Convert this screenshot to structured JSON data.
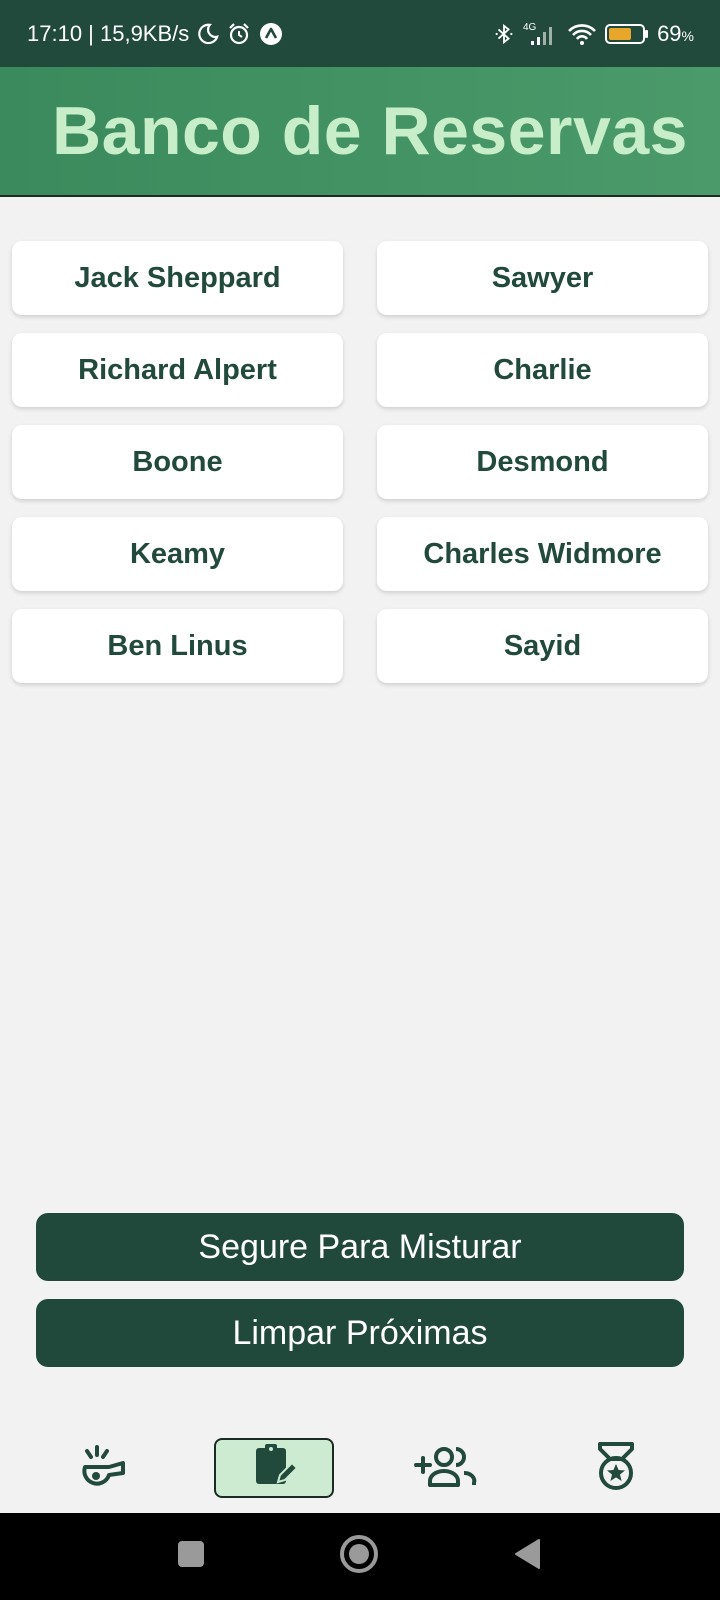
{
  "status_bar": {
    "time_speed": "17:10 | 15,9KB/s",
    "network": "4G",
    "battery_percent": "69",
    "battery_unit": "%",
    "battery_level": 0.69,
    "battery_color": "#e8a62a",
    "left_icons": [
      "moon-icon",
      "alarm-icon",
      "app-notification-icon"
    ],
    "right_icons": [
      "bluetooth-icon",
      "signal-icon",
      "wifi-icon",
      "battery-icon"
    ]
  },
  "header": {
    "title": "Banco de Reservas"
  },
  "players": [
    "Jack Sheppard",
    "Sawyer",
    "Richard Alpert",
    "Charlie",
    "Boone",
    "Desmond",
    "Keamy",
    "Charles Widmore",
    "Ben Linus",
    "Sayid"
  ],
  "actions": {
    "mix_label": "Segure Para Misturar",
    "clear_label": "Limpar Próximas"
  },
  "bottom_nav": {
    "items": [
      {
        "icon": "whistle-icon",
        "active": false
      },
      {
        "icon": "edit-note-icon",
        "active": true
      },
      {
        "icon": "add-team-icon",
        "active": false
      },
      {
        "icon": "medal-icon",
        "active": false
      }
    ]
  },
  "colors": {
    "header_bg": "#4b9a6a",
    "title": "#c8edc9",
    "primary_dark": "#21493b",
    "card_text": "#224a3c",
    "active_nav_bg": "#ccebd0",
    "page_bg": "#f2f2f2"
  }
}
